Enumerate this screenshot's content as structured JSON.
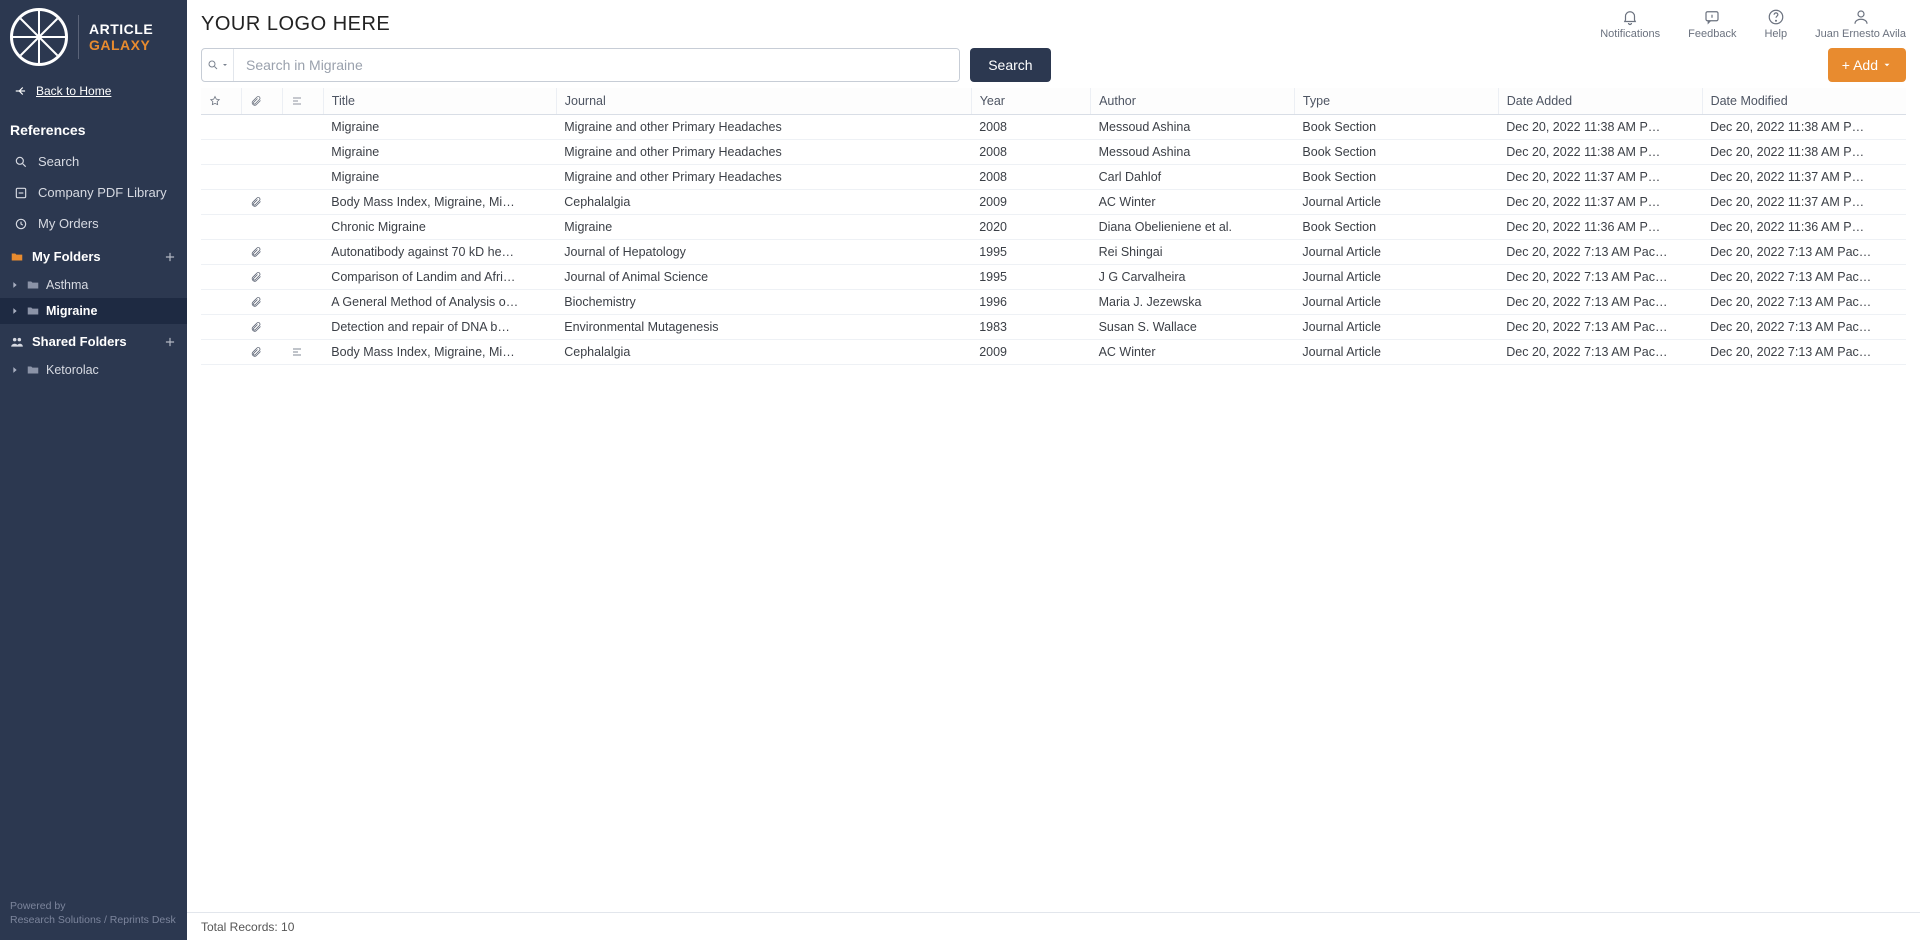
{
  "logo": {
    "line1": "ARTICLE",
    "line2": "GALAXY"
  },
  "sidebar": {
    "back_home": "Back to Home",
    "references_title": "References",
    "nav": {
      "search": "Search",
      "pdf_library": "Company PDF Library",
      "my_orders": "My Orders"
    },
    "my_folders_title": "My Folders",
    "my_folders": [
      {
        "label": "Asthma",
        "active": false
      },
      {
        "label": "Migraine",
        "active": true
      }
    ],
    "shared_folders_title": "Shared Folders",
    "shared_folders": [
      {
        "label": "Ketorolac"
      }
    ],
    "footer_l1": "Powered by",
    "footer_l2": "Research Solutions / Reprints Desk"
  },
  "header": {
    "brand": "YOUR LOGO HERE",
    "actions": {
      "notifications": "Notifications",
      "feedback": "Feedback",
      "help": "Help",
      "user": "Juan Ernesto Avila"
    }
  },
  "search": {
    "placeholder": "Search in Migraine",
    "button": "Search"
  },
  "add_button": "+ Add",
  "columns": {
    "title": "Title",
    "journal": "Journal",
    "year": "Year",
    "author": "Author",
    "type": "Type",
    "date_added": "Date Added",
    "date_modified": "Date Modified"
  },
  "rows": [
    {
      "attach": false,
      "note": false,
      "title": "Migraine",
      "journal": "Migraine and other Primary Headaches",
      "year": "2008",
      "author": "Messoud Ashina",
      "type": "Book Section",
      "added": "Dec 20, 2022 11:38 AM P…",
      "modified": "Dec 20, 2022 11:38 AM P…"
    },
    {
      "attach": false,
      "note": false,
      "title": "Migraine",
      "journal": "Migraine and other Primary Headaches",
      "year": "2008",
      "author": "Messoud Ashina",
      "type": "Book Section",
      "added": "Dec 20, 2022 11:38 AM P…",
      "modified": "Dec 20, 2022 11:38 AM P…"
    },
    {
      "attach": false,
      "note": false,
      "title": "Migraine",
      "journal": "Migraine and other Primary Headaches",
      "year": "2008",
      "author": "Carl Dahlof",
      "type": "Book Section",
      "added": "Dec 20, 2022 11:37 AM P…",
      "modified": "Dec 20, 2022 11:37 AM P…"
    },
    {
      "attach": true,
      "note": false,
      "title": "Body Mass Index, Migraine, Mi…",
      "journal": "Cephalalgia",
      "year": "2009",
      "author": "AC Winter",
      "type": "Journal Article",
      "added": "Dec 20, 2022 11:37 AM P…",
      "modified": "Dec 20, 2022 11:37 AM P…"
    },
    {
      "attach": false,
      "note": false,
      "title": "Chronic Migraine",
      "journal": "Migraine",
      "year": "2020",
      "author": "Diana Obelieniene et al.",
      "type": "Book Section",
      "added": "Dec 20, 2022 11:36 AM P…",
      "modified": "Dec 20, 2022 11:36 AM P…"
    },
    {
      "attach": true,
      "note": false,
      "title": "Autonatibody against 70 kD he…",
      "journal": "Journal of Hepatology",
      "year": "1995",
      "author": "Rei Shingai",
      "type": "Journal Article",
      "added": "Dec 20, 2022 7:13 AM Pac…",
      "modified": "Dec 20, 2022 7:13 AM Pac…"
    },
    {
      "attach": true,
      "note": false,
      "title": "Comparison of Landim and Afri…",
      "journal": "Journal of Animal Science",
      "year": "1995",
      "author": "J G Carvalheira",
      "type": "Journal Article",
      "added": "Dec 20, 2022 7:13 AM Pac…",
      "modified": "Dec 20, 2022 7:13 AM Pac…"
    },
    {
      "attach": true,
      "note": false,
      "title": "A General Method of Analysis o…",
      "journal": "Biochemistry",
      "year": "1996",
      "author": "Maria J. Jezewska",
      "type": "Journal Article",
      "added": "Dec 20, 2022 7:13 AM Pac…",
      "modified": "Dec 20, 2022 7:13 AM Pac…"
    },
    {
      "attach": true,
      "note": false,
      "title": "Detection and repair of DNA b…",
      "journal": "Environmental Mutagenesis",
      "year": "1983",
      "author": "Susan S. Wallace",
      "type": "Journal Article",
      "added": "Dec 20, 2022 7:13 AM Pac…",
      "modified": "Dec 20, 2022 7:13 AM Pac…"
    },
    {
      "attach": true,
      "note": true,
      "title": "Body Mass Index, Migraine, Mi…",
      "journal": "Cephalalgia",
      "year": "2009",
      "author": "AC Winter",
      "type": "Journal Article",
      "added": "Dec 20, 2022 7:13 AM Pac…",
      "modified": "Dec 20, 2022 7:13 AM Pac…"
    }
  ],
  "status": {
    "total_records": "Total Records: 10"
  }
}
